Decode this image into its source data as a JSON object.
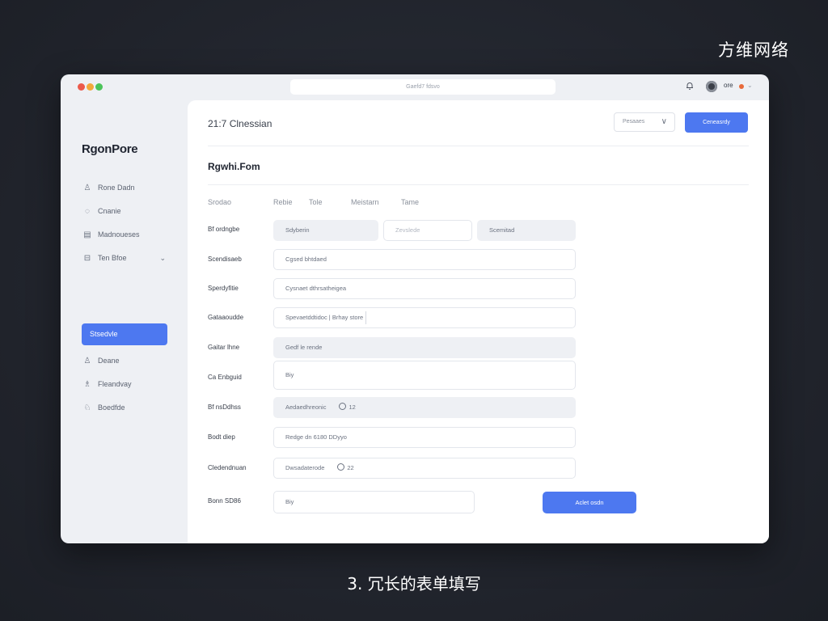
{
  "brand": "方维网络",
  "caption": "3. 冗长的表单填写",
  "titlebar": {
    "url": "Gaefd7 fdsvo",
    "user_label": "ore"
  },
  "sidebar": {
    "app_name": "RgonPore",
    "items": [
      {
        "label": "Rone Dadn",
        "icon": "user-icon"
      },
      {
        "label": "Cnanie",
        "icon": "chat-icon"
      },
      {
        "label": "Madnoueses",
        "icon": "document-icon"
      },
      {
        "label": "Ten Bfoe",
        "icon": "folder-icon"
      },
      {
        "label": "Stsedvle",
        "icon": ""
      },
      {
        "label": "Deane",
        "icon": "user-icon"
      },
      {
        "label": "Fleandvay",
        "icon": "group-icon"
      },
      {
        "label": "Boedfde",
        "icon": "settings-icon"
      }
    ]
  },
  "header": {
    "title": "21:7 Clnessian",
    "select_label": "Pesaaes",
    "button_label": "Ceneasrdy"
  },
  "form": {
    "title": "Rgwhi.Fom",
    "columns": [
      "Srodao",
      "Rebie",
      "Tole",
      "Meistarn",
      "Tame"
    ],
    "rows": [
      {
        "label": "Bf ordngbe",
        "fields": [
          "Sdyberin",
          "Zevslede",
          "Scemitad"
        ]
      },
      {
        "label": "Scendisaeb",
        "fields": [
          "Cgsed bhtdaed"
        ]
      },
      {
        "label": "Sperdyfitie",
        "fields": [
          "Cysnaet dthrsatheigea"
        ]
      },
      {
        "label": "Gataaoudde",
        "fields": [
          "Spevaetddtidoc  | Brhay store"
        ]
      },
      {
        "label": "Gaitar lhne",
        "fields": [
          "Gedf le rende"
        ]
      },
      {
        "label": "Ca Enbguid",
        "fields": [
          "Biy"
        ]
      },
      {
        "label": "Bf nsDdhss",
        "fields": [
          "Aedaedhreonic"
        ],
        "suffix": "12"
      },
      {
        "label": "Bodt diep",
        "fields": [
          "Redge dn 6180 DDyyo"
        ]
      },
      {
        "label": "Cledendnuan",
        "fields": [
          "Dwsadaterode"
        ],
        "suffix": "22"
      },
      {
        "label": "Bonn SD86",
        "fields": [
          "Biy"
        ]
      }
    ],
    "submit_label": "Aclet osdn"
  }
}
